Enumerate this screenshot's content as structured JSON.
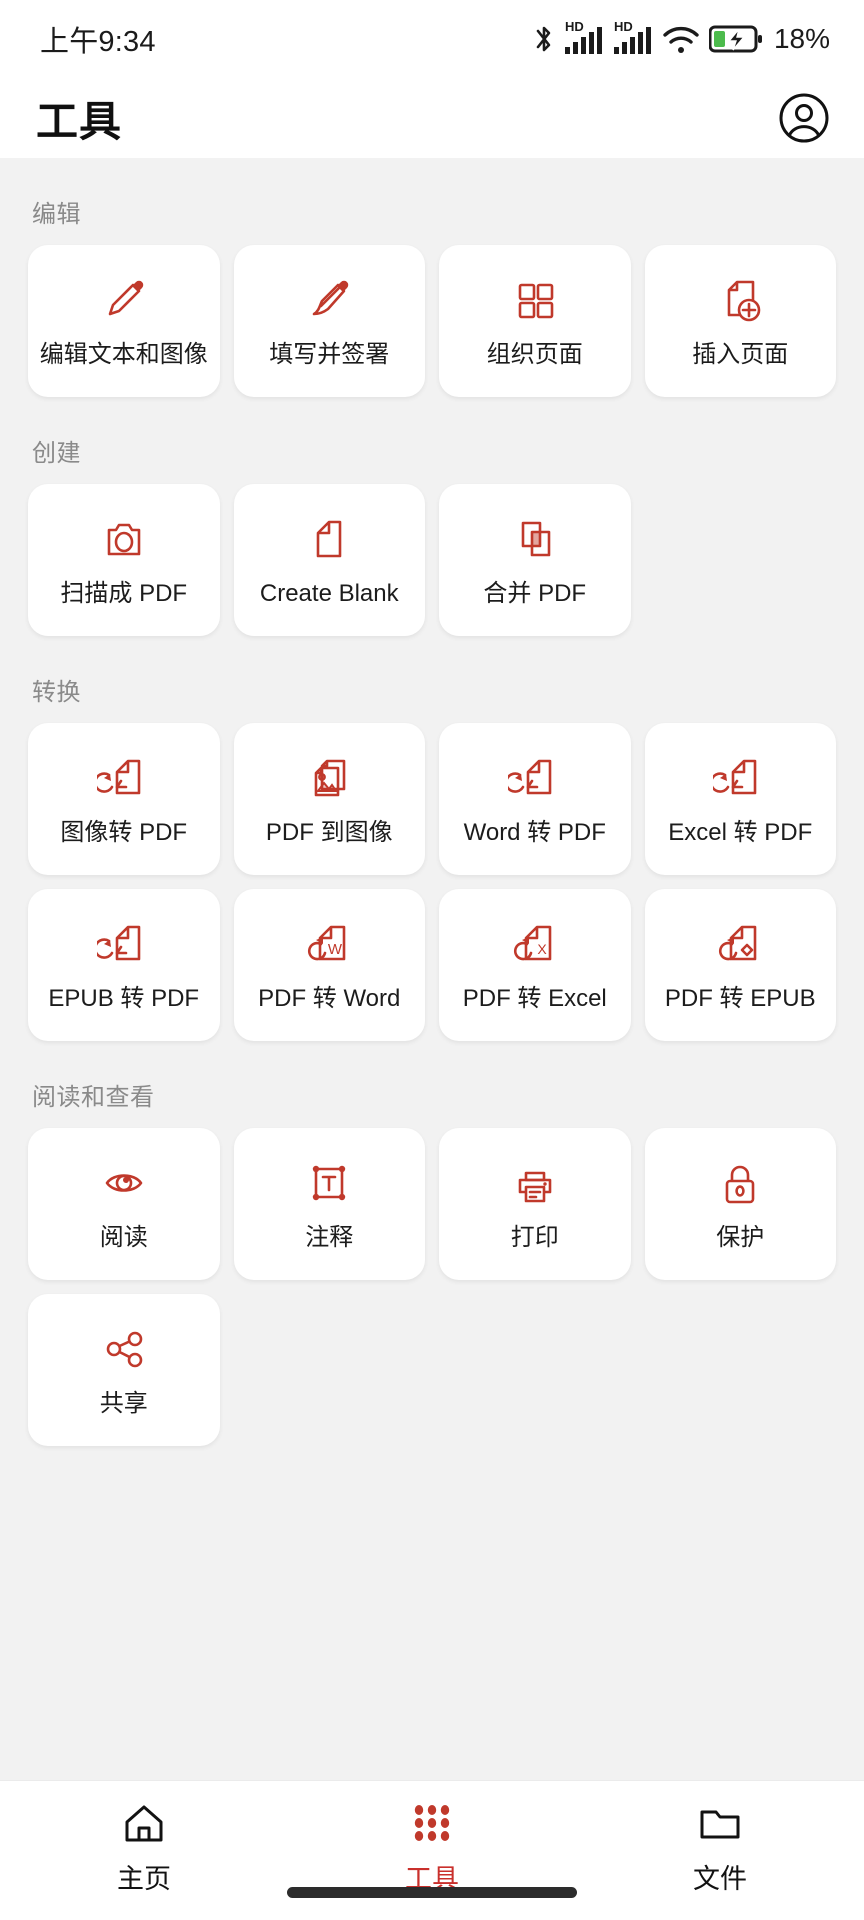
{
  "status_bar": {
    "time": "上午9:34",
    "battery_percent": "18%",
    "icons": [
      "bluetooth-icon",
      "hd-signal-icon",
      "hd-signal-icon",
      "wifi-icon",
      "battery-charging-icon"
    ],
    "battery_level": 25,
    "battery_color": "#4cbb4c"
  },
  "header": {
    "title": "工具",
    "avatar_icon": "account-circle-icon"
  },
  "theme": {
    "accent": "#c0392b",
    "icon_red": "#c0392b",
    "page_bg": "#f2f2f2",
    "card_bg": "#ffffff",
    "section_label": "#8a8a8a",
    "text": "#1c1c1c"
  },
  "sections": [
    {
      "title": "编辑",
      "items": [
        {
          "label": "编辑文本和图像",
          "icon": "pencil-icon"
        },
        {
          "label": "填写并签署",
          "icon": "sign-pen-icon"
        },
        {
          "label": "组织页面",
          "icon": "grid-four-squares-icon"
        },
        {
          "label": "插入页面",
          "icon": "page-plus-icon"
        }
      ]
    },
    {
      "title": "创建",
      "items": [
        {
          "label": "扫描成 PDF",
          "icon": "camera-icon"
        },
        {
          "label": "Create Blank",
          "icon": "blank-page-icon"
        },
        {
          "label": "合并 PDF",
          "icon": "merge-squares-icon"
        }
      ]
    },
    {
      "title": "转换",
      "items": [
        {
          "label": "图像转 PDF",
          "icon": "convert-to-pdf-icon"
        },
        {
          "label": "PDF 到图像",
          "icon": "pdf-to-image-icon"
        },
        {
          "label": "Word 转 PDF",
          "icon": "convert-to-pdf-icon"
        },
        {
          "label": "Excel 转 PDF",
          "icon": "convert-to-pdf-icon"
        },
        {
          "label": "EPUB 转 PDF",
          "icon": "convert-to-pdf-icon"
        },
        {
          "label": "PDF 转 Word",
          "icon": "pdf-to-word-icon"
        },
        {
          "label": "PDF 转 Excel",
          "icon": "pdf-to-excel-icon"
        },
        {
          "label": "PDF 转 EPUB",
          "icon": "pdf-to-epub-icon"
        }
      ]
    },
    {
      "title": "阅读和查看",
      "items": [
        {
          "label": "阅读",
          "icon": "eye-icon"
        },
        {
          "label": "注释",
          "icon": "text-annotate-icon"
        },
        {
          "label": "打印",
          "icon": "printer-icon"
        },
        {
          "label": "保护",
          "icon": "lock-icon"
        },
        {
          "label": "共享",
          "icon": "share-icon"
        }
      ]
    }
  ],
  "bottom_nav": {
    "items": [
      {
        "label": "主页",
        "icon": "home-icon",
        "active": false
      },
      {
        "label": "工具",
        "icon": "grid-dots-icon",
        "active": true
      },
      {
        "label": "文件",
        "icon": "folder-icon",
        "active": false
      }
    ]
  }
}
